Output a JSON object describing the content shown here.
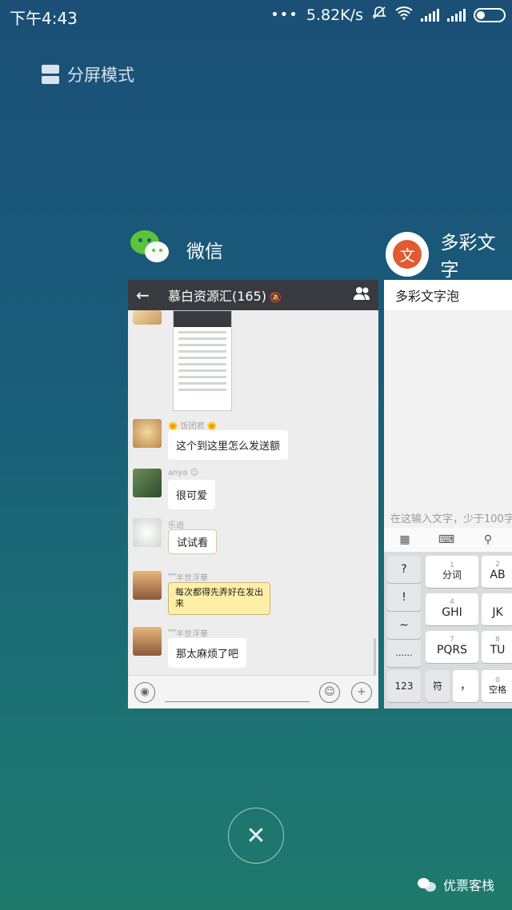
{
  "status_bar": {
    "time": "下午4:43",
    "dots": "•••",
    "speed": "5.82K/s",
    "icons": [
      "mute-icon",
      "wifi-icon",
      "signal-icon",
      "signal-icon",
      "battery-icon"
    ]
  },
  "split_mode": {
    "label": "分屏模式"
  },
  "apps": [
    {
      "name": "微信"
    },
    {
      "name": "多彩文字"
    }
  ],
  "wechat": {
    "chat_title": "慕白资源汇(165)",
    "messages": [
      {
        "nick": "🌞 饭团君 🌞",
        "text": "这个到这里怎么发送额"
      },
      {
        "nick": "anya ☺",
        "text": "很可爱"
      },
      {
        "nick": "乐逍",
        "text": "试试看"
      },
      {
        "nick": "﹌半世浮華",
        "text": "每次都得先弄好在发出来"
      },
      {
        "nick": "﹌半世浮華",
        "text": "那太麻烦了吧"
      }
    ]
  },
  "duocai": {
    "title": "多彩文字泡",
    "input_hint": "在这输入文字，少于100字",
    "keys": {
      "side": [
        "?",
        "!",
        "~",
        "......"
      ],
      "k1_num": "1",
      "k1": "分词",
      "k2_num": "2",
      "k2": "AB",
      "k4_num": "4",
      "k4": "GHI",
      "k5": "JK",
      "k7_num": "7",
      "k7": "PQRS",
      "k8_num": "8",
      "k8": "TU",
      "k0_num": "0",
      "k0": "空格",
      "num": "123",
      "sym": "符",
      "comma": "，"
    }
  },
  "watermark": "优票客栈"
}
